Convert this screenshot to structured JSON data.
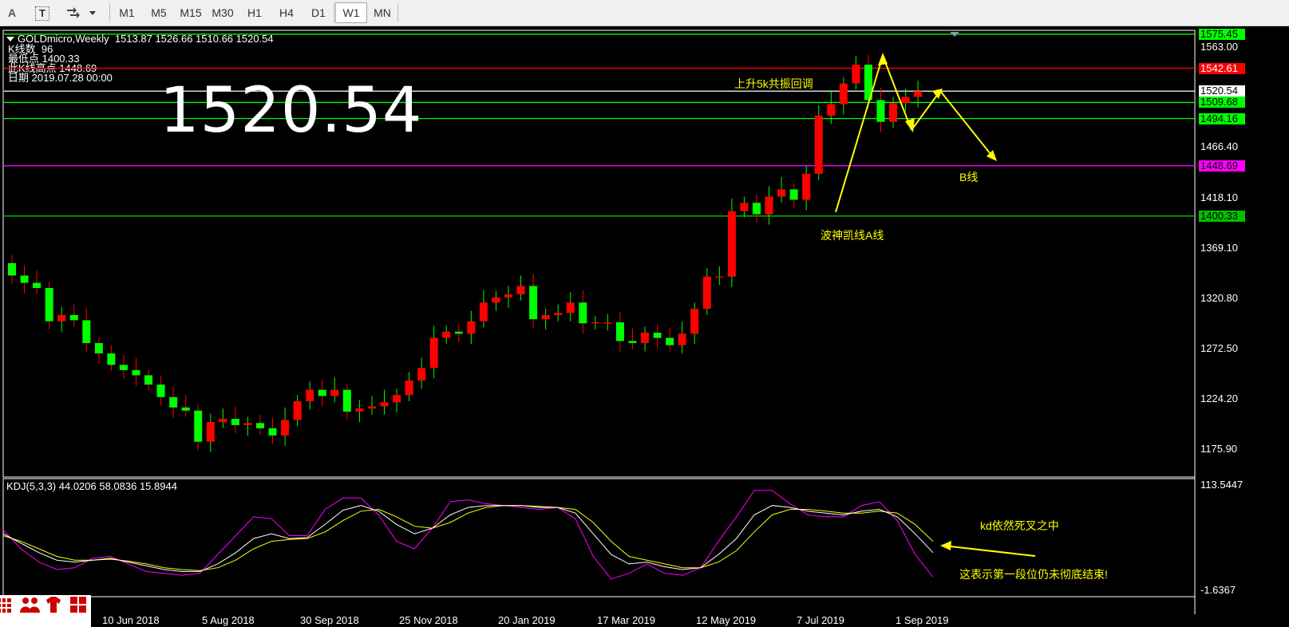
{
  "toolbar": {
    "text_tool": "A",
    "text_label_tool": "T",
    "timeframes": [
      "M1",
      "M5",
      "M15",
      "M30",
      "H1",
      "H4",
      "D1",
      "W1",
      "MN"
    ],
    "active_timeframe": "W1"
  },
  "chart": {
    "header": "GOLDmicro,Weekly  1513.87 1526.66 1510.66 1520.54",
    "info_lines": [
      "K线数  96",
      "最低点 1400.33",
      "此K线高点 1448.69",
      "日期 2019.07.28 00:00"
    ],
    "big_price": "1520.54",
    "annotations": {
      "top": "上升5k共振回调",
      "b_line": "B线",
      "a_line": "波神凯线A线",
      "kd_dead": "kd依然死叉之中",
      "first_stage": "这表示第一段位仍未彻底结束!"
    },
    "price_axis": [
      "1563.00",
      "1466.40",
      "1418.10",
      "1369.10",
      "1320.80",
      "1272.50",
      "1224.20",
      "1175.90"
    ],
    "levels": [
      {
        "value": "1575.45",
        "color": "#00ff00",
        "text": "#000000"
      },
      {
        "value": "1542.61",
        "color": "#ff0000",
        "text": "#ffffff"
      },
      {
        "value": "1520.54",
        "color": "#ffffff",
        "text": "#000000"
      },
      {
        "value": "1509.68",
        "color": "#00ff00",
        "text": "#000000"
      },
      {
        "value": "1494.16",
        "color": "#00ff00",
        "text": "#000000"
      },
      {
        "value": "1448.69",
        "color": "#ff00ff",
        "text": "#000000"
      },
      {
        "value": "1400.33",
        "color": "#00c000",
        "text": "#000000"
      }
    ],
    "dates": [
      "10 Jun 2018",
      "5 Aug 2018",
      "30 Sep 2018",
      "25 Nov 2018",
      "20 Jan 2019",
      "17 Mar 2019",
      "12 May 2019",
      "7 Jul 2019",
      "1 Sep 2019"
    ],
    "bull_color": "#00ff00",
    "bear_color": "#ff0000"
  },
  "oscillator": {
    "title": "KDJ(5,3,3) 44.0206 58.0836 15.8944",
    "axis_top": "113.5447",
    "axis_bottom": "-1.6367",
    "k_color": "#ffffff",
    "d_color": "#ffff00",
    "j_color": "#ff00ff"
  }
}
